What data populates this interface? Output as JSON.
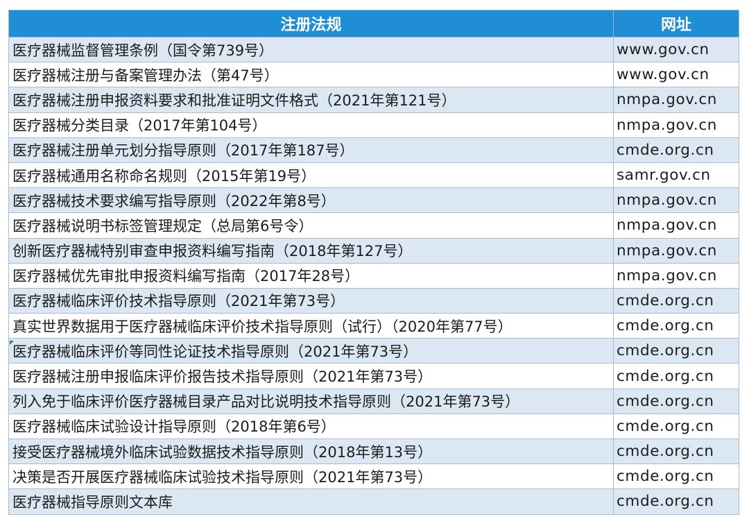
{
  "table": {
    "headers": [
      "注册法规",
      "网址"
    ],
    "rows": [
      [
        "医疗器械监督管理条例（国令第739号）",
        "www.gov.cn"
      ],
      [
        "医疗器械注册与备案管理办法（第47号）",
        "www.gov.cn"
      ],
      [
        "医疗器械注册申报资料要求和批准证明文件格式（2021年第121号）",
        "nmpa.gov.cn"
      ],
      [
        "医疗器械分类目录（2017年第104号）",
        "nmpa.gov.cn"
      ],
      [
        "医疗器械注册单元划分指导原则（2017年第187号）",
        "cmde.org.cn"
      ],
      [
        "医疗器械通用名称命名规则（2015年第19号）",
        "samr.gov.cn"
      ],
      [
        "医疗器械技术要求编写指导原则（2022年第8号）",
        "nmpa.gov.cn"
      ],
      [
        "医疗器械说明书标签管理规定（总局第6号令）",
        "nmpa.gov.cn"
      ],
      [
        "创新医疗器械特别审查申报资料编写指南（2018年第127号）",
        "nmpa.gov.cn"
      ],
      [
        "医疗器械优先审批申报资料编写指南（2017年28号）",
        "nmpa.gov.cn"
      ],
      [
        "医疗器械临床评价技术指导原则（2021年第73号）",
        "cmde.org.cn"
      ],
      [
        "真实世界数据用于医疗器械临床评价技术指导原则（试行）（2020年第77号）",
        "cmde.org.cn"
      ],
      [
        " 医疗器械临床评价等同性论证技术指导原则（2021年第73号）",
        "cmde.org.cn"
      ],
      [
        "医疗器械注册申报临床评价报告技术指导原则（2021年第73号）",
        "cmde.org.cn"
      ],
      [
        "列入免于临床评价医疗器械目录产品对比说明技术指导原则（2021年第73号）",
        "cmde.org.cn"
      ],
      [
        "医疗器械临床试验设计指导原则（2018年第6号）",
        "cmde.org.cn"
      ],
      [
        "接受医疗器械境外临床试验数据技术指导原则（2018年第13号）",
        "cmde.org.cn"
      ],
      [
        "决策是否开展医疗器械临床试验技术指导原则（2021年第73号）",
        "cmde.org.cn"
      ],
      [
        "医疗器械指导原则文本库",
        "cmde.org.cn"
      ]
    ]
  },
  "colors": {
    "header_bg": "#1f8ed4",
    "header_text": "#ffffff",
    "stripe": "#dbe8f4",
    "border": "#a9bccb"
  }
}
